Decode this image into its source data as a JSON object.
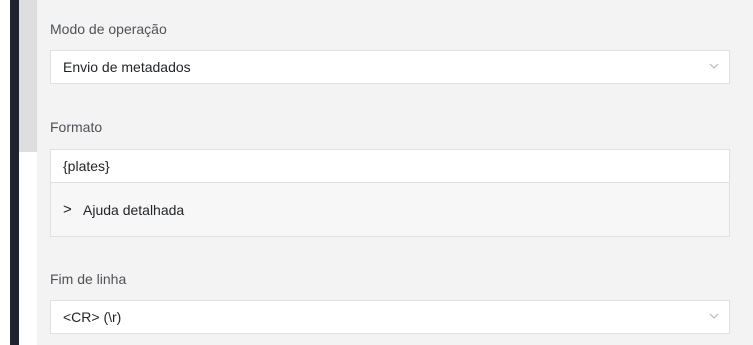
{
  "form": {
    "mode": {
      "label": "Modo de operação",
      "value": "Envio de metadados"
    },
    "format": {
      "label": "Formato",
      "value": "{plates}"
    },
    "help": {
      "caret": ">",
      "label": "Ajuda detalhada"
    },
    "line_end": {
      "label": "Fim de linha",
      "value": "<CR> (\\r)"
    }
  },
  "icons": {
    "dropdown": "chevron-down-icon",
    "expand": "chevron-right-icon"
  },
  "colors": {
    "sidebar": "#20232e",
    "panel_bg": "#f3f3f4",
    "input_bg": "#ffffff",
    "border": "#e0e0e2",
    "label_text": "#4f5155",
    "value_text": "#222428",
    "scroll_thumb": "#dedede"
  }
}
